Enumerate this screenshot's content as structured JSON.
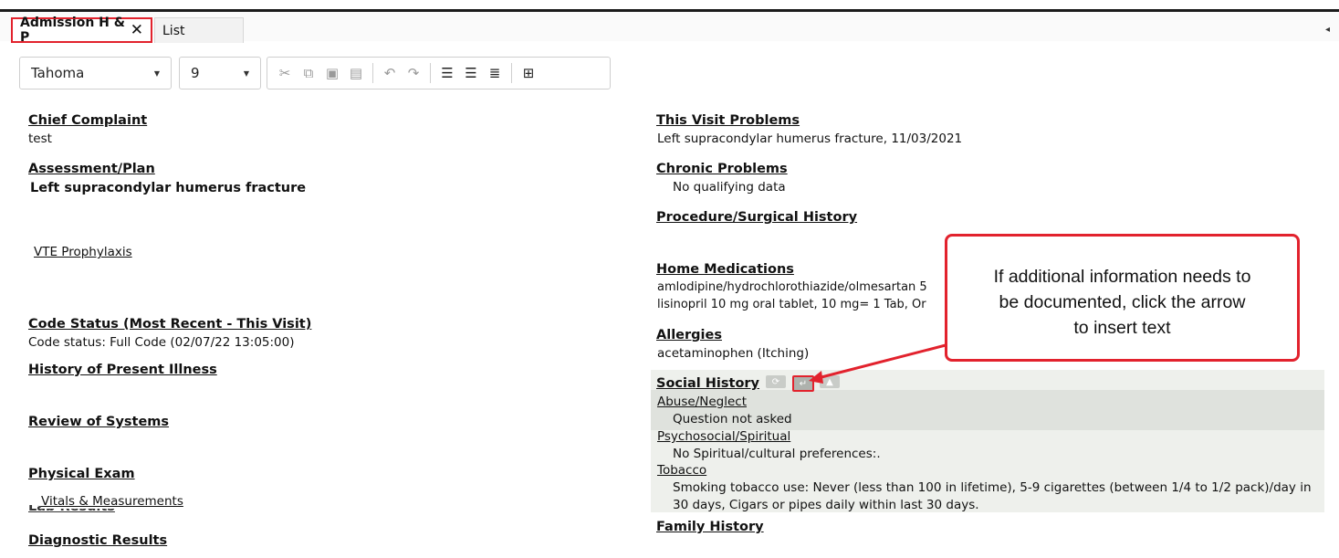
{
  "tabs": [
    {
      "label": "Admission H & P",
      "close": "✕"
    },
    {
      "label": "List"
    }
  ],
  "tabstrip": {
    "collapse_glyph": "◂"
  },
  "toolbar": {
    "font_family": "Tahoma",
    "font_size": "9",
    "buttons": [
      "cut",
      "copy",
      "paste",
      "paste-special",
      "undo",
      "redo",
      "align-center",
      "align-right",
      "justify",
      "insert-field"
    ]
  },
  "left": {
    "chief_complaint_title": "Chief Complaint",
    "chief_complaint_value": "test",
    "assessment_title": "Assessment/Plan",
    "assessment_value": "Left supracondylar humerus fracture",
    "vte_link": "VTE Prophylaxis",
    "code_status_title": "Code Status (Most Recent - This Visit)",
    "code_status_value": "Code status: Full Code (02/07/22 13:05:00)",
    "hpi_title": "History of Present Illness",
    "ros_title": "Review of Systems",
    "pe_title": "Physical Exam",
    "vitals_link": "Vitals & Measurements",
    "lab_results_title": "Lab Results",
    "diagnostic_title": "Diagnostic Results"
  },
  "right": {
    "visit_problems_title": "This Visit Problems",
    "visit_problems_value": "Left supracondylar humerus fracture, 11/03/2021",
    "chronic_title": "Chronic Problems",
    "chronic_value": "No qualifying data",
    "procedure_title": "Procedure/Surgical History",
    "home_meds_title": "Home Medications",
    "home_meds_1": "amlodipine/hydrochlorothiazide/olmesartan 5",
    "home_meds_2": "lisinopril 10 mg oral tablet, 10 mg= 1 Tab, Or",
    "allergies_title": "Allergies",
    "allergies_value": "acetaminophen (Itching)",
    "social_title": "Social History",
    "abuse_title": "Abuse/Neglect",
    "abuse_value": "Question not asked",
    "psycho_title": "Psychosocial/Spiritual",
    "psycho_value": "No Spiritual/cultural preferences:.",
    "tobacco_title": "Tobacco",
    "tobacco_value_1": "Smoking tobacco use: Never (less than 100 in lifetime), 5-9 cigarettes (between 1/4 to 1/2 pack)/day in",
    "tobacco_value_2": "30 days, Cigars or pipes daily within last 30 days.",
    "family_title": "Family History"
  },
  "callout": {
    "line1": "If additional information needs to",
    "line2": "be documented, click the arrow",
    "line3": "to insert text"
  },
  "colors": {
    "highlight": "#e2222d",
    "panel": "#eef0ec"
  }
}
